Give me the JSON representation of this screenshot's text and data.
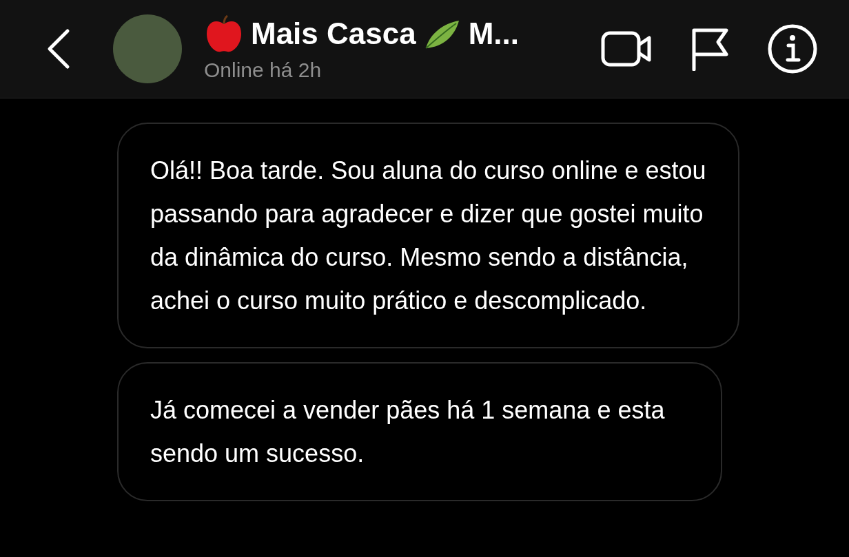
{
  "header": {
    "title": "Mais Casca",
    "title_rest": "M...",
    "status": "Online há 2h"
  },
  "messages": [
    {
      "text": "Olá!! Boa tarde. Sou aluna do curso online e estou passando para agradecer e dizer que gostei muito da dinâmica do curso. Mesmo sendo a distância, achei o curso muito prático e descomplicado."
    },
    {
      "text": "Já comecei a vender pães há 1 semana e esta sendo um sucesso."
    }
  ]
}
